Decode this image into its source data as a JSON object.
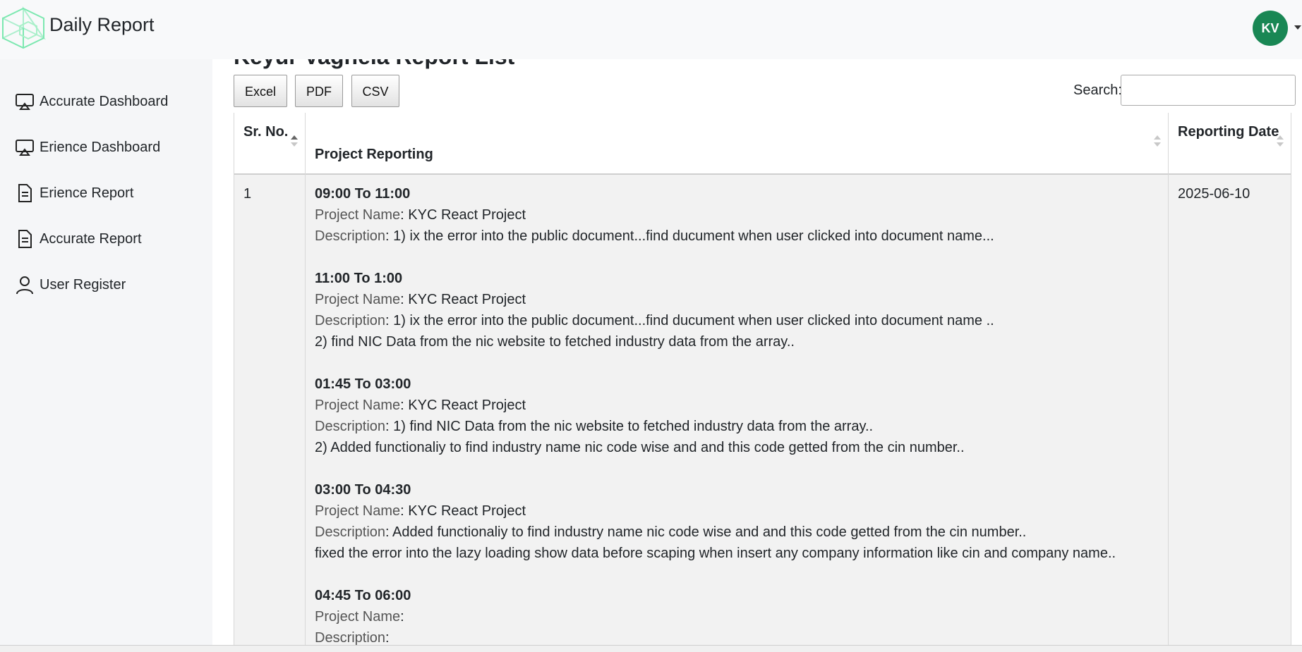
{
  "app": {
    "title": "Daily Report",
    "avatar_initials": "KV",
    "accent_color": "#198754"
  },
  "sidebar": {
    "items": [
      {
        "label": "Accurate Dashboard",
        "icon": "monitor-icon"
      },
      {
        "label": "Erience Dashboard",
        "icon": "monitor-icon"
      },
      {
        "label": "Erience Report",
        "icon": "document-icon"
      },
      {
        "label": "Accurate Report",
        "icon": "document-icon"
      },
      {
        "label": "User Register",
        "icon": "user-icon"
      }
    ]
  },
  "page": {
    "title": "Keyur Vaghela Report List"
  },
  "toolbar": {
    "excel": "Excel",
    "pdf": "PDF",
    "csv": "CSV",
    "search_label": "Search:",
    "search_value": ""
  },
  "table": {
    "columns": [
      "Sr. No.",
      "Project Reporting",
      "Reporting Date"
    ],
    "sort_column": "Sr. No.",
    "rows": [
      {
        "sr": "1",
        "date": "2025-06-10",
        "project_label": "Project Name",
        "description_label": "Description",
        "entries": [
          {
            "slot": "09:00 To 11:00",
            "project": ": KYC React Project",
            "desc": ": 1) ix the error into the public document...find ducument when user clicked into document name...",
            "extra": []
          },
          {
            "slot": "11:00 To 1:00",
            "project": ": KYC React Project",
            "desc": ": 1) ix the error into the public document...find ducument when user clicked into document name ..",
            "extra": [
              "2) find NIC Data from the nic website to fetched industry data from the array.."
            ]
          },
          {
            "slot": "01:45 To 03:00",
            "project": ": KYC React Project",
            "desc": ": 1) find NIC Data from the nic website to fetched industry data from the array..",
            "extra": [
              "2) Added functionaliy to find industry name nic code wise and and this code getted from the cin number.."
            ]
          },
          {
            "slot": "03:00 To 04:30",
            "project": ": KYC React Project",
            "desc": ": Added functionaliy to find industry name nic code wise and and this code getted from the cin number..",
            "extra": [
              "fixed the error into the lazy loading show data before scaping when insert any company information like cin and company name.."
            ]
          },
          {
            "slot": "04:45 To 06:00",
            "project": ":",
            "desc": ":",
            "extra": []
          }
        ]
      }
    ]
  }
}
